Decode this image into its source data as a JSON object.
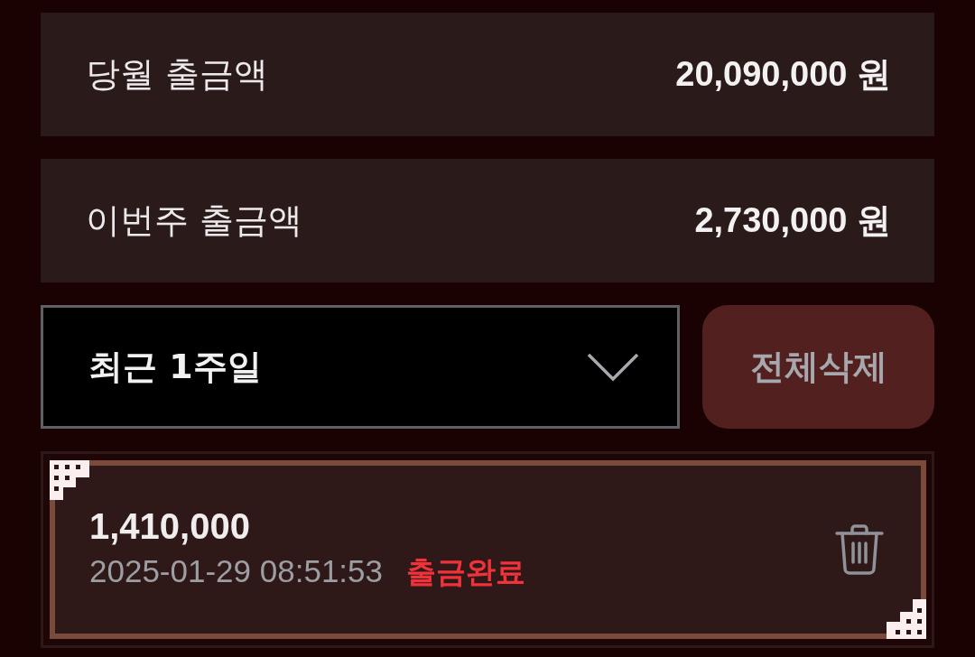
{
  "summary": [
    {
      "label": "당월 출금액",
      "amount": "20,090,000 원"
    },
    {
      "label": "이번주 출금액",
      "amount": "2,730,000 원"
    }
  ],
  "filter": {
    "value": "최근 1주일"
  },
  "delete_all_button": "전체삭제",
  "transactions": [
    {
      "amount": "1,410,000",
      "datetime": "2025-01-29 08:51:53",
      "status": {
        "text": "출금완료",
        "kind": "done"
      }
    }
  ]
}
